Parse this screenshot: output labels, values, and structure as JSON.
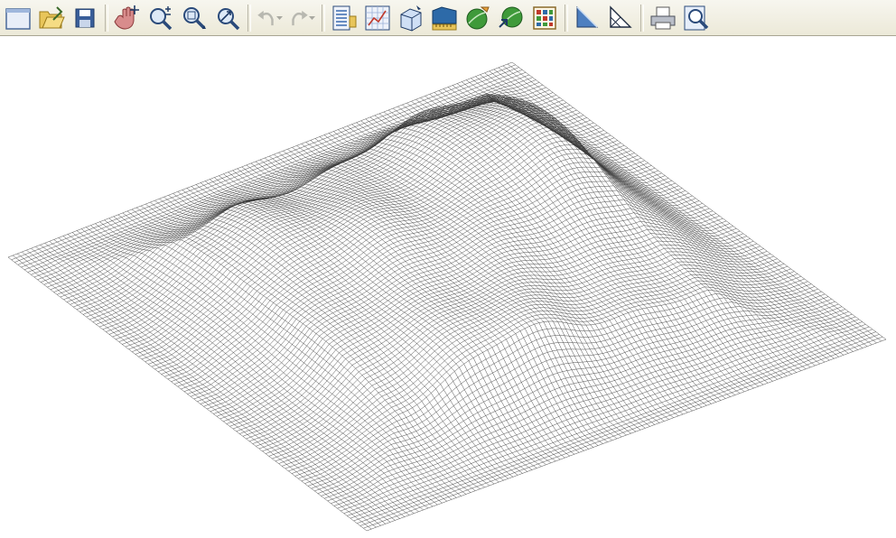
{
  "toolbar": {
    "buttons": [
      {
        "name": "new-file-button",
        "icon": "new-document-icon",
        "group": 1
      },
      {
        "name": "open-file-button",
        "icon": "open-folder-icon",
        "group": 1
      },
      {
        "name": "save-button",
        "icon": "floppy-disk-icon",
        "group": 1
      },
      {
        "name": "pan-button",
        "icon": "hand-pan-icon",
        "group": 2
      },
      {
        "name": "zoom-in-out-button",
        "icon": "zoom-plus-minus-icon",
        "group": 2
      },
      {
        "name": "zoom-window-button",
        "icon": "zoom-window-icon",
        "group": 2
      },
      {
        "name": "zoom-extents-button",
        "icon": "zoom-extents-icon",
        "group": 2
      },
      {
        "name": "undo-button",
        "icon": "undo-arrow-icon",
        "group": 3,
        "disabled": true
      },
      {
        "name": "redo-button",
        "icon": "redo-arrow-icon",
        "group": 3,
        "disabled": true
      },
      {
        "name": "layer-properties-button",
        "icon": "layer-properties-icon",
        "group": 4
      },
      {
        "name": "grid-map-button",
        "icon": "grid-map-icon",
        "group": 4
      },
      {
        "name": "3d-box-button",
        "icon": "3d-box-icon",
        "group": 4
      },
      {
        "name": "volume-measure-button",
        "icon": "volume-ruler-icon",
        "group": 4
      },
      {
        "name": "wireframe-globe-button",
        "icon": "globe-pencil-icon",
        "group": 4
      },
      {
        "name": "surface-globe-button",
        "icon": "globe-arrow-icon",
        "group": 4
      },
      {
        "name": "color-grid-button",
        "icon": "color-grid-icon",
        "group": 4
      },
      {
        "name": "shaded-triangle-button",
        "icon": "shaded-triangle-icon",
        "group": 5
      },
      {
        "name": "wire-triangle-button",
        "icon": "wire-triangle-icon",
        "group": 5
      },
      {
        "name": "print-button",
        "icon": "printer-icon",
        "group": 6
      },
      {
        "name": "print-preview-button",
        "icon": "print-preview-icon",
        "group": 6
      }
    ]
  },
  "viewport": {
    "background": "#ffffff",
    "mesh_color": "#3a3a3a",
    "content": "wireframe-terrain-surface"
  }
}
